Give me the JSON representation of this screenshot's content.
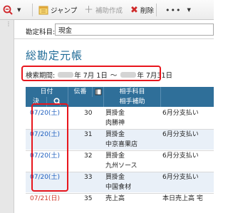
{
  "toolbar": {
    "jump_label": "ジャンプ",
    "supplement_label": "補助作成",
    "delete_label": "削除",
    "more_label": "•••"
  },
  "account": {
    "label": "勘定科目:",
    "selected": "現金"
  },
  "page": {
    "title": "総勘定元帳"
  },
  "period": {
    "label": "検索期間:",
    "start_month_day": "年 7月 1日",
    "separator": "～",
    "end_month_day": "年 7月31日"
  },
  "table": {
    "headers": {
      "date": "日付",
      "voucher": "伝番",
      "counter_account": "相手科目",
      "settle": "決",
      "counter_sub": "相手補助"
    },
    "rows": [
      {
        "date": "07/20(土)",
        "voucher": "30",
        "account": "買掛金",
        "summary": "6月分支払い",
        "sub": "肉勝神"
      },
      {
        "date": "07/20(土)",
        "voucher": "31",
        "account": "買掛金",
        "summary": "6月分支払い",
        "sub": "中京喜果店"
      },
      {
        "date": "07/20(土)",
        "voucher": "32",
        "account": "買掛金",
        "summary": "6月分支払い",
        "sub": "九州ソース"
      },
      {
        "date": "07/20(土)",
        "voucher": "33",
        "account": "買掛金",
        "summary": "6月分支払い",
        "sub": "中国食材"
      },
      {
        "date": "07/21(日)",
        "voucher": "35",
        "account": "売上高",
        "summary": "本日売上高 宅",
        "sub": ""
      }
    ]
  },
  "colors": {
    "header_blue": "#2f6f99",
    "highlight_red": "#e8161d",
    "date_blue": "#1f5fbf"
  }
}
